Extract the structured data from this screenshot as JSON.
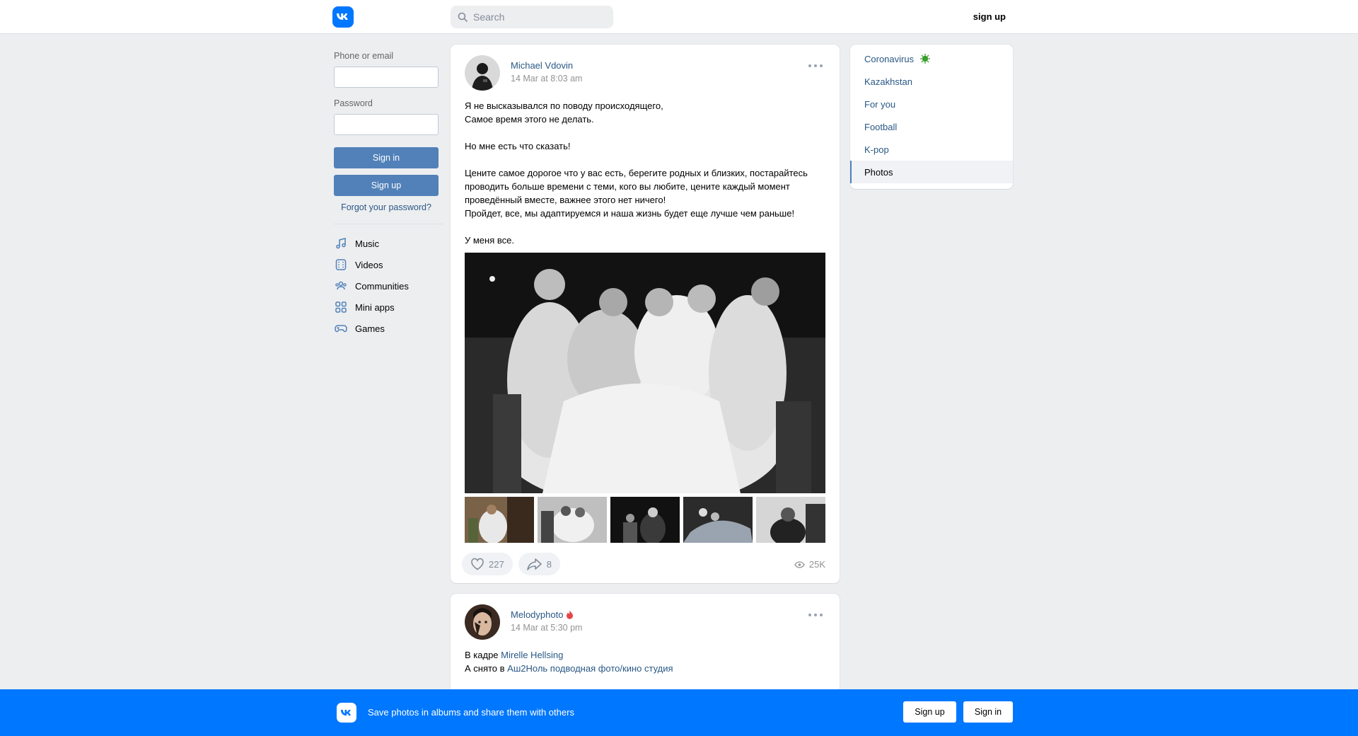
{
  "header": {
    "search_placeholder": "Search",
    "signup_label": "sign up"
  },
  "login": {
    "phone_label": "Phone or email",
    "password_label": "Password",
    "signin_label": "Sign in",
    "signup_label": "Sign up",
    "forgot_label": "Forgot your password?"
  },
  "sidebar": {
    "items": [
      {
        "label": "Music",
        "icon": "music-icon"
      },
      {
        "label": "Videos",
        "icon": "video-icon"
      },
      {
        "label": "Communities",
        "icon": "communities-icon"
      },
      {
        "label": "Mini apps",
        "icon": "mini-apps-icon"
      },
      {
        "label": "Games",
        "icon": "gamepad-icon"
      }
    ]
  },
  "post1": {
    "author": "Michael Vdovin",
    "date": "14 Mar at 8:03 am",
    "line1": "Я не высказывался по поводу происходящего,",
    "line2": "Самое время этого не делать.",
    "line3": "Но мне есть что сказать!",
    "line4": "Цените самое дорогое что у вас есть, берегите родных и близких, постарайтесь проводить больше времени с теми, кого вы любите, цените каждый момент проведённый вместе, важнее этого нет ничего!",
    "line5": "Пройдет, все, мы адаптируемся и наша жизнь будет еще лучше чем раньше!",
    "line6": "У меня все.",
    "likes": "227",
    "shares": "8",
    "views": "25K"
  },
  "post2": {
    "author": "Melodyphoto",
    "date": "14 Mar at 5:30 pm",
    "line1_prefix": "В кадре ",
    "line1_link": "Mirelle Hellsing",
    "line2_prefix": "А снято в ",
    "line2_link": "Аш2Ноль подводная фото/кино студия"
  },
  "right_menu": {
    "items": [
      "Coronavirus",
      "Kazakhstan",
      "For you",
      "Football",
      "K-pop",
      "Photos"
    ],
    "active": "Photos"
  },
  "bottom_bar": {
    "text": "Save photos in albums and share them with others",
    "signup_label": "Sign up",
    "signin_label": "Sign in"
  },
  "colors": {
    "brand": "#0077ff",
    "link": "#2a5885",
    "button": "#5181b8"
  }
}
